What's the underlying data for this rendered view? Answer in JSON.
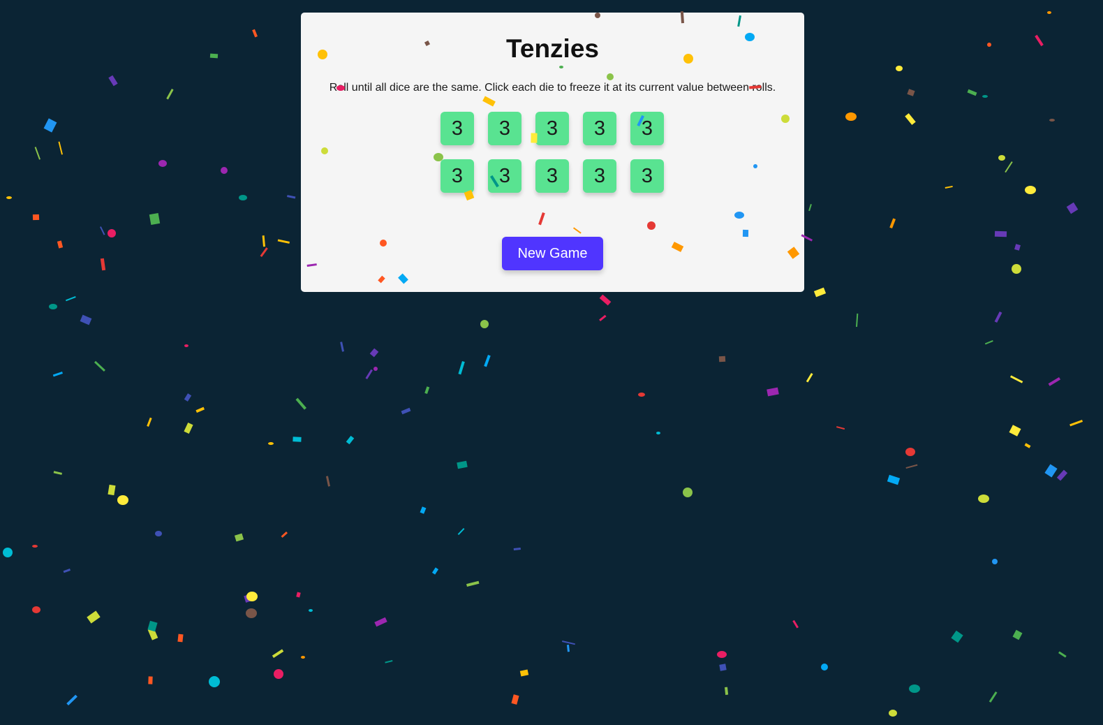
{
  "game": {
    "title": "Tenzies",
    "instructions": "Roll until all dice are the same. Click each die to freeze it at its current value between rolls.",
    "dice": [
      "3",
      "3",
      "3",
      "3",
      "3",
      "3",
      "3",
      "3",
      "3",
      "3"
    ],
    "dice_held": [
      true,
      true,
      true,
      true,
      true,
      true,
      true,
      true,
      true,
      true
    ],
    "new_game_label": "New Game"
  },
  "colors": {
    "background": "#0b2434",
    "board": "#f5f5f5",
    "die_held": "#59e391",
    "button": "#5035ff",
    "confetti": [
      "#e53935",
      "#ff9800",
      "#ffc107",
      "#cddc39",
      "#8bc34a",
      "#4caf50",
      "#009688",
      "#00bcd4",
      "#03a9f4",
      "#2196f3",
      "#3f51b5",
      "#673ab7",
      "#9c27b0",
      "#e91e63",
      "#ff5722",
      "#795548",
      "#ffeb3b"
    ]
  },
  "effects": {
    "confetti_visible": true
  }
}
